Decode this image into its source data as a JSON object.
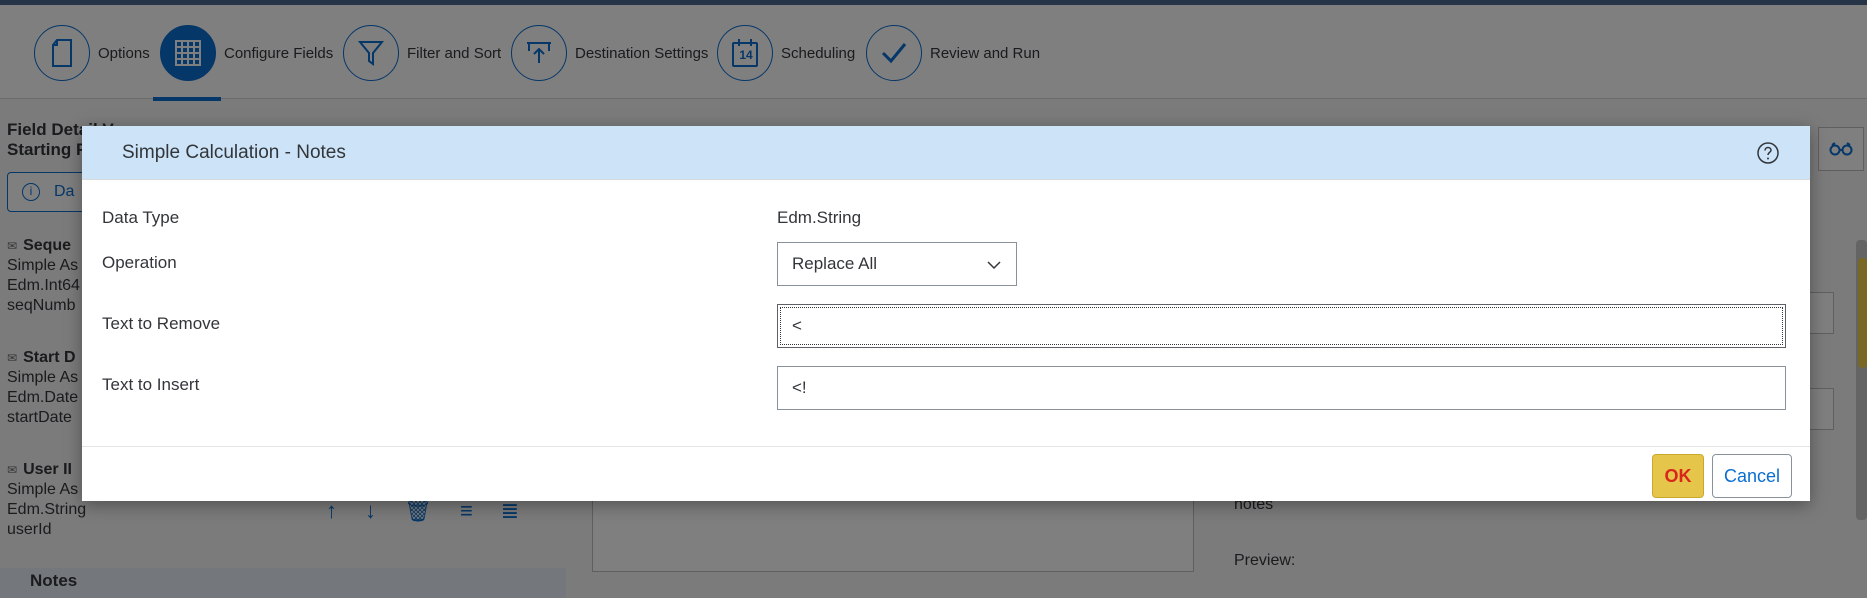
{
  "wizard": {
    "steps": [
      {
        "label": "Options",
        "icon": "document-icon"
      },
      {
        "label": "Configure Fields",
        "icon": "grid-icon",
        "active": true
      },
      {
        "label": "Filter and Sort",
        "icon": "filter-icon"
      },
      {
        "label": "Destination Settings",
        "icon": "upload-icon"
      },
      {
        "label": "Scheduling",
        "icon": "calendar-icon"
      },
      {
        "label": "Review and Run",
        "icon": "checkmark-icon"
      }
    ],
    "calendar_day": "14"
  },
  "background": {
    "left_title": "Field Detail V",
    "left_subtitle": "Starting F",
    "info_chip": "Da",
    "fields": [
      {
        "name": "Seque",
        "line1": "Simple As",
        "line2": "Edm.Int64",
        "line3": "seqNumb"
      },
      {
        "name": "Start D",
        "line1": "Simple As",
        "line2": "Edm.Date",
        "line3": "startDate"
      },
      {
        "name": "User II",
        "line1": "Simple As",
        "line2": "Edm.String",
        "line3": "userId"
      }
    ],
    "notes_row": "Notes",
    "right_notes": "notes",
    "right_preview": "Preview:"
  },
  "dialog": {
    "title": "Simple Calculation - Notes",
    "data_type_label": "Data Type",
    "data_type_value": "Edm.String",
    "operation_label": "Operation",
    "operation_value": "Replace All",
    "remove_label": "Text to Remove",
    "remove_value": "<",
    "insert_label": "Text to Insert",
    "insert_value": "<!",
    "ok_label": "OK",
    "cancel_label": "Cancel"
  },
  "colors": {
    "accent": "#0a6ed1",
    "header_bg": "#cde4f8",
    "ok_bg": "#e5c64a",
    "ok_text": "#d9261c"
  }
}
